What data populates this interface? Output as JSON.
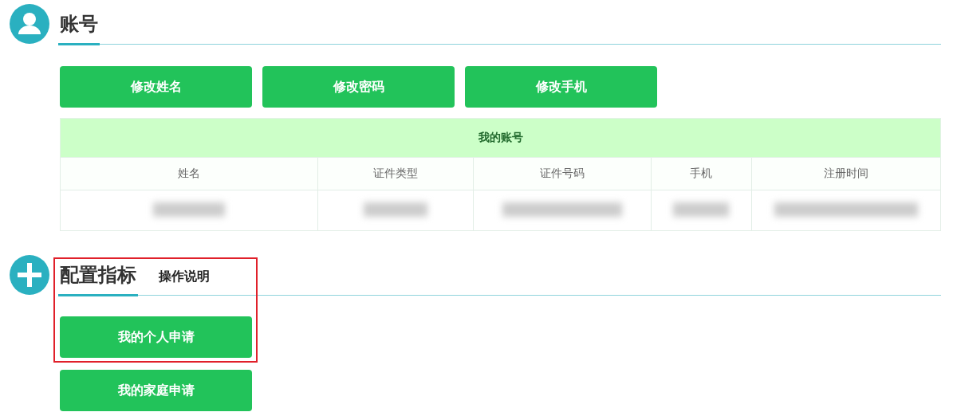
{
  "sections": [
    {
      "kind": "user",
      "title": "账号",
      "highlighted": false,
      "buttons": [
        "修改姓名",
        "修改密码",
        "修改手机"
      ],
      "table": {
        "caption": "我的账号",
        "columns": [
          "姓名",
          "证件类型",
          "证件号码",
          "手机",
          "注册时间"
        ],
        "rows": [
          {
            "redacted": true
          }
        ]
      }
    },
    {
      "kind": "plus",
      "title": "配置指标",
      "link": "操作说明",
      "highlighted": true,
      "buttons": [
        "我的个人申请",
        "我的家庭申请"
      ]
    }
  ]
}
